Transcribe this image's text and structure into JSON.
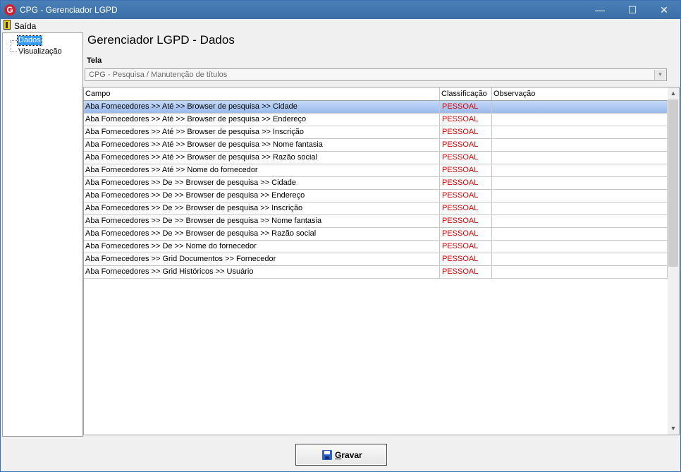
{
  "window": {
    "title": "CPG - Gerenciador LGPD",
    "minimize": "—",
    "maximize": "☐",
    "close": "✕"
  },
  "menu": {
    "exit_label": "Saída"
  },
  "tree": {
    "items": [
      {
        "label": "Dados",
        "selected": true
      },
      {
        "label": "Visualização",
        "selected": false
      }
    ]
  },
  "main": {
    "title": "Gerenciador LGPD - Dados",
    "tela_label": "Tela",
    "tela_value": "CPG - Pesquisa / Manutenção de títulos"
  },
  "grid": {
    "columns": [
      "Campo",
      "Classificação",
      "Observação"
    ],
    "rows": [
      {
        "campo": "Aba Fornecedores >> Até >> Browser de pesquisa >> Cidade",
        "classificacao": "PESSOAL",
        "observacao": ""
      },
      {
        "campo": "Aba Fornecedores >> Até >> Browser de pesquisa >> Endereço",
        "classificacao": "PESSOAL",
        "observacao": ""
      },
      {
        "campo": "Aba Fornecedores >> Até >> Browser de pesquisa >> Inscrição",
        "classificacao": "PESSOAL",
        "observacao": ""
      },
      {
        "campo": "Aba Fornecedores >> Até >> Browser de pesquisa >> Nome fantasia",
        "classificacao": "PESSOAL",
        "observacao": ""
      },
      {
        "campo": "Aba Fornecedores >> Até >> Browser de pesquisa >> Razão social",
        "classificacao": "PESSOAL",
        "observacao": ""
      },
      {
        "campo": "Aba Fornecedores >> Até >> Nome do fornecedor",
        "classificacao": "PESSOAL",
        "observacao": ""
      },
      {
        "campo": "Aba Fornecedores >> De >> Browser de pesquisa >> Cidade",
        "classificacao": "PESSOAL",
        "observacao": ""
      },
      {
        "campo": "Aba Fornecedores >> De >> Browser de pesquisa >> Endereço",
        "classificacao": "PESSOAL",
        "observacao": ""
      },
      {
        "campo": "Aba Fornecedores >> De >> Browser de pesquisa >> Inscrição",
        "classificacao": "PESSOAL",
        "observacao": ""
      },
      {
        "campo": "Aba Fornecedores >> De >> Browser de pesquisa >> Nome fantasia",
        "classificacao": "PESSOAL",
        "observacao": ""
      },
      {
        "campo": "Aba Fornecedores >> De >> Browser de pesquisa >> Razão social",
        "classificacao": "PESSOAL",
        "observacao": ""
      },
      {
        "campo": "Aba Fornecedores >> De >> Nome do fornecedor",
        "classificacao": "PESSOAL",
        "observacao": ""
      },
      {
        "campo": "Aba Fornecedores >> Grid Documentos >> Fornecedor",
        "classificacao": "PESSOAL",
        "observacao": ""
      },
      {
        "campo": "Aba Fornecedores >> Grid Históricos >> Usuário",
        "classificacao": "PESSOAL",
        "observacao": ""
      }
    ],
    "selected_row": 0
  },
  "footer": {
    "save_label": "Gravar"
  },
  "colors": {
    "titlebar": "#3a6ea5",
    "classification": "#e00000",
    "selection": "#3399ff",
    "row_selected": "#aac8f0"
  },
  "icons": {
    "app": "app-logo-icon",
    "exit": "exit-door-icon",
    "save": "floppy-disk-icon"
  }
}
